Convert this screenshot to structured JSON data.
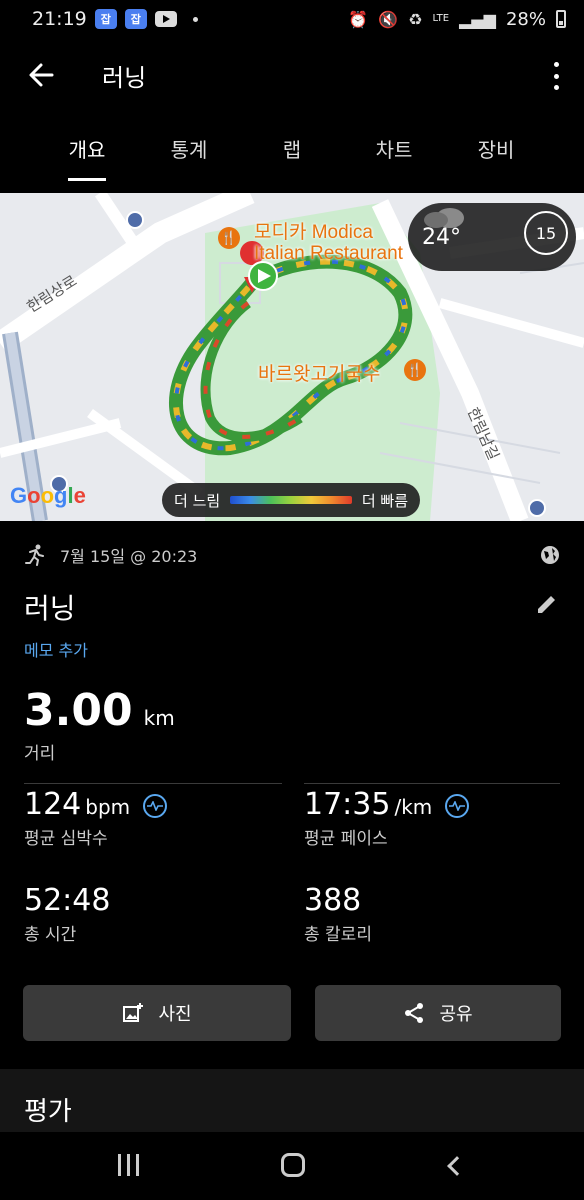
{
  "status_bar": {
    "time": "21:19",
    "badge1": "잡",
    "badge2": "잡",
    "network": "LTE",
    "battery": "28%"
  },
  "app_bar": {
    "title": "러닝"
  },
  "tabs": [
    {
      "label": "개요",
      "active": true
    },
    {
      "label": "통계",
      "active": false
    },
    {
      "label": "랩",
      "active": false
    },
    {
      "label": "차트",
      "active": false
    },
    {
      "label": "장비",
      "active": false
    }
  ],
  "map": {
    "poi_1_line1": "모디카 Modica",
    "poi_1_line2": "Italian Restaurant",
    "poi_2": "바르왓고기국수",
    "road_1": "한림상로",
    "road_2": "한림남길",
    "weather_temp": "24°",
    "uv_index": "15",
    "legend_slow": "더 느림",
    "legend_fast": "더 빠름",
    "google_logo": "Google"
  },
  "activity": {
    "date": "7월 15일 @ 20:23",
    "title": "러닝",
    "memo_link": "메모 추가",
    "distance_value": "3.00",
    "distance_unit": "km",
    "distance_label": "거리",
    "avg_hr_value": "124",
    "avg_hr_unit": "bpm",
    "avg_hr_label": "평균 심박수",
    "avg_pace_value": "17:35",
    "avg_pace_unit": "/km",
    "avg_pace_label": "평균 페이스",
    "total_time_value": "52:48",
    "total_time_label": "총 시간",
    "calories_value": "388",
    "calories_label": "총 칼로리"
  },
  "buttons": {
    "photo": "사진",
    "share": "공유"
  },
  "rating": {
    "title": "평가"
  }
}
